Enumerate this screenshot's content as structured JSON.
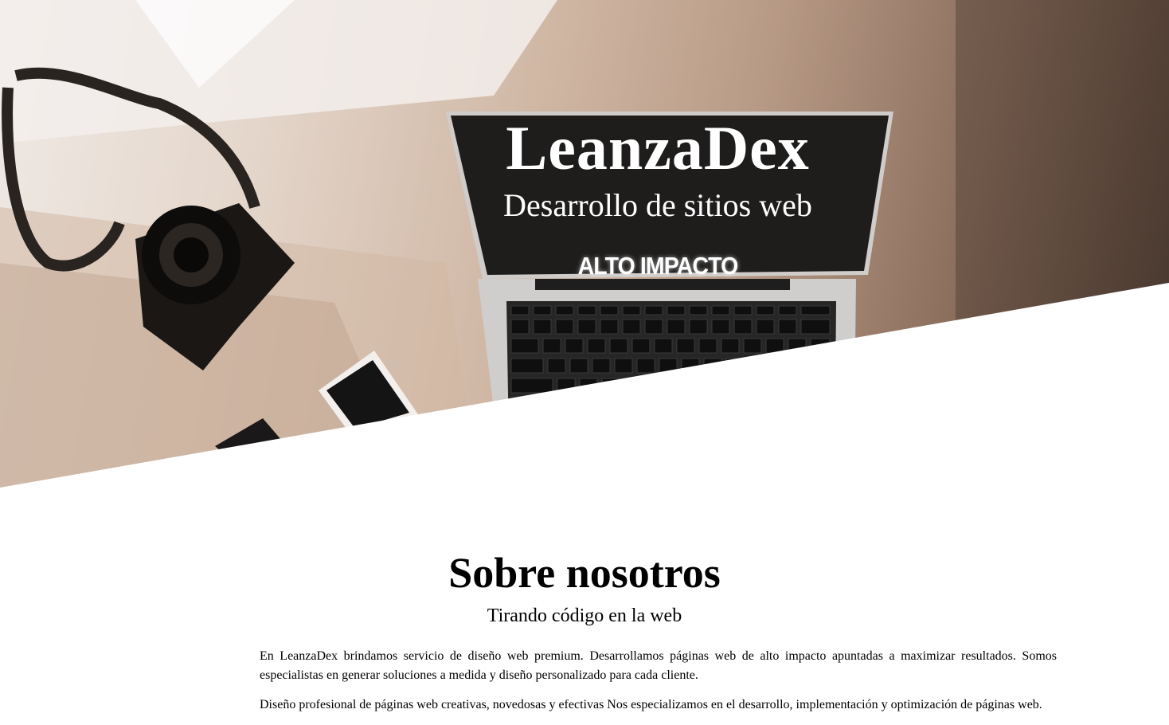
{
  "hero": {
    "title": "LeanzaDex",
    "subtitle": "Desarrollo de sitios web",
    "tagline": "ALTO IMPACTO"
  },
  "about": {
    "title": "Sobre nosotros",
    "subtitle": "Tirando código en la web",
    "paragraphs": [
      "En LeanzaDex brindamos servicio de diseño web premium. Desarrollamos páginas web de alto impacto apuntadas a maximizar resultados. Somos especialistas en generar soluciones a medida y diseño personalizado para cada cliente.",
      "Diseño profesional de páginas web creativas, novedosas y efectivas Nos especializamos en el desarrollo, implementación y optimización de páginas web."
    ]
  },
  "colors": {
    "background": "#ffffff",
    "text": "#000000",
    "hero_text": "#ffffff"
  },
  "icons": [
    "hero-photo-camera",
    "hero-photo-laptop",
    "hero-photo-phone"
  ]
}
